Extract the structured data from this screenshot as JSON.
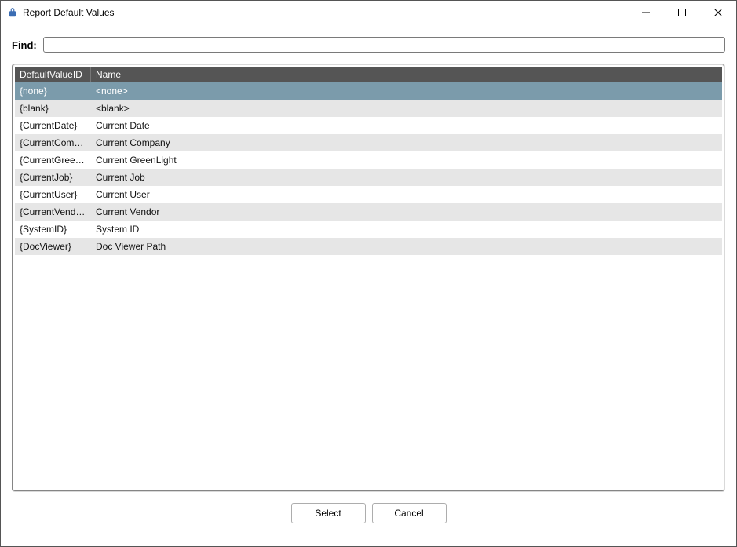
{
  "window": {
    "title": "Report Default Values",
    "icon": "lock-icon"
  },
  "find": {
    "label": "Find:",
    "value": ""
  },
  "grid": {
    "headers": {
      "id": "DefaultValueID",
      "name": "Name"
    },
    "rows": [
      {
        "id": "{none}",
        "name": "<none>",
        "selected": true
      },
      {
        "id": "{blank}",
        "name": "<blank>"
      },
      {
        "id": "{CurrentDate}",
        "name": "Current Date"
      },
      {
        "id": "{CurrentCompany}",
        "name": "Current Company"
      },
      {
        "id": "{CurrentGreenLig...",
        "name": "Current GreenLight"
      },
      {
        "id": "{CurrentJob}",
        "name": "Current Job"
      },
      {
        "id": "{CurrentUser}",
        "name": "Current User"
      },
      {
        "id": "{CurrentVendor}",
        "name": "Current Vendor"
      },
      {
        "id": "{SystemID}",
        "name": "System ID"
      },
      {
        "id": "{DocViewer}",
        "name": "Doc Viewer Path"
      }
    ]
  },
  "footer": {
    "select": "Select",
    "cancel": "Cancel"
  }
}
